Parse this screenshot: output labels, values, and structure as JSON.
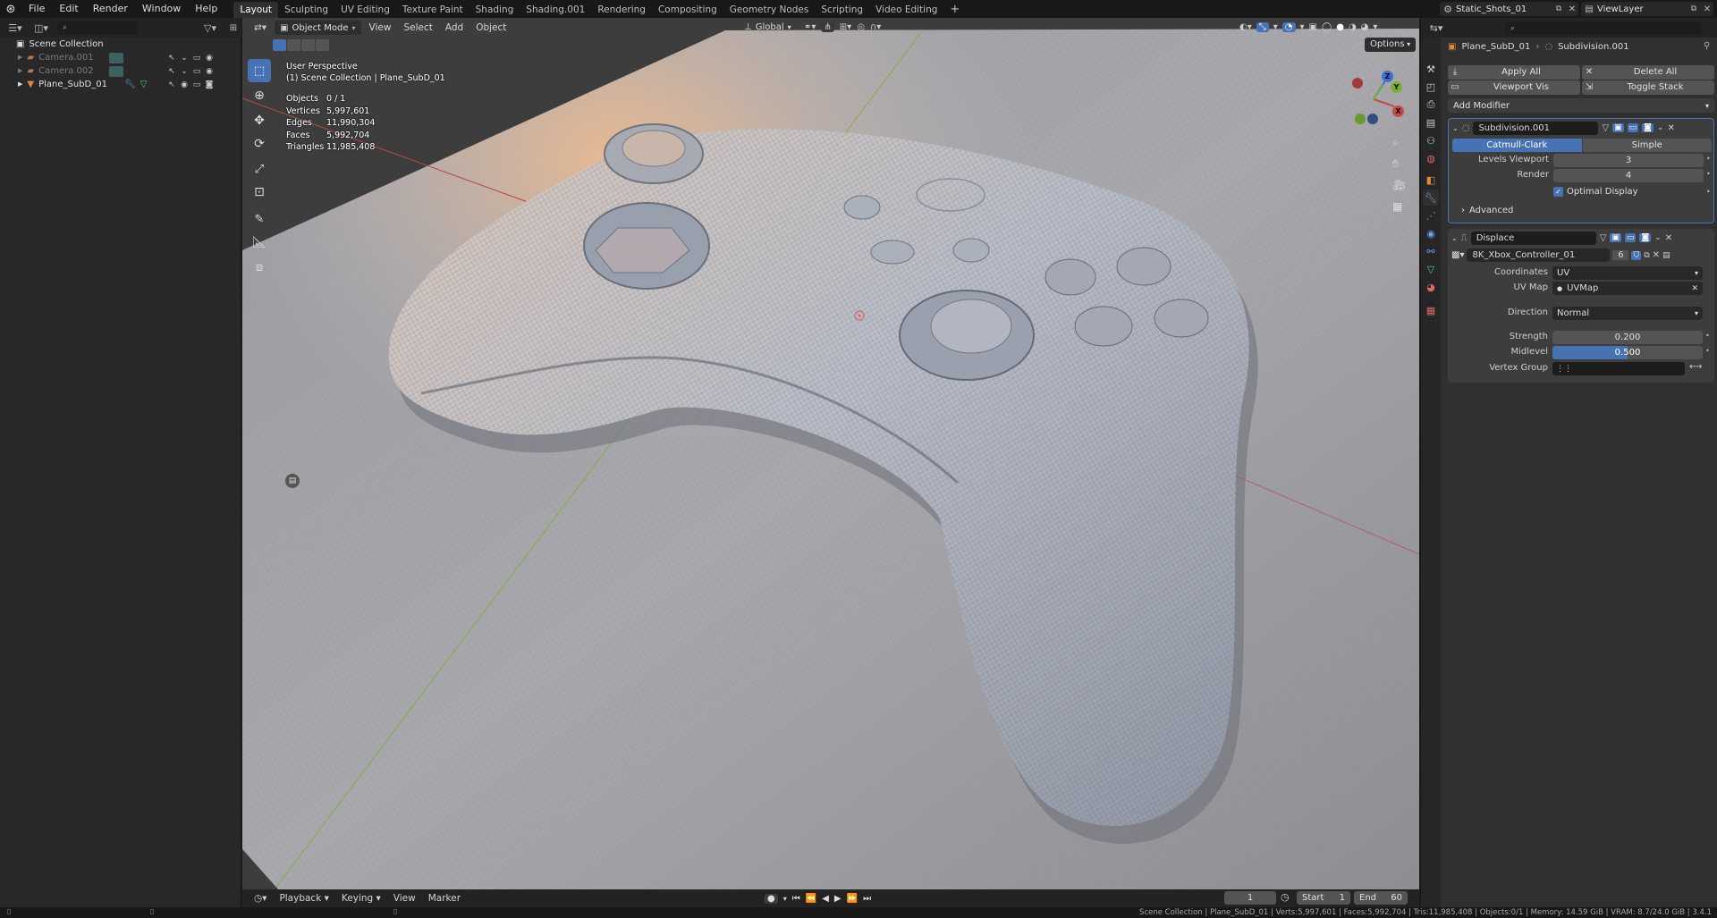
{
  "topbar": {
    "menus": [
      "File",
      "Edit",
      "Render",
      "Window",
      "Help"
    ],
    "workspaces": [
      "Layout",
      "Sculpting",
      "UV Editing",
      "Texture Paint",
      "Shading",
      "Shading.001",
      "Rendering",
      "Compositing",
      "Geometry Nodes",
      "Scripting",
      "Video Editing"
    ],
    "active_workspace": "Layout",
    "add_tab": "+",
    "scene_name": "Static_Shots_01",
    "view_layer": "ViewLayer"
  },
  "outliner": {
    "root": "Scene Collection",
    "items": [
      {
        "name": "Camera.001",
        "enabled": false
      },
      {
        "name": "Camera.002",
        "enabled": false
      },
      {
        "name": "Plane_SubD_01",
        "enabled": true
      }
    ]
  },
  "viewport": {
    "mode": "Object Mode",
    "menus": [
      "View",
      "Select",
      "Add",
      "Object"
    ],
    "orientation": "Global",
    "options": "Options",
    "title": "User Perspective",
    "context": "(1) Scene Collection | Plane_SubD_01",
    "stats": [
      {
        "label": "Objects",
        "value": "0 / 1"
      },
      {
        "label": "Vertices",
        "value": "5,997,601"
      },
      {
        "label": "Edges",
        "value": "11,990,304"
      },
      {
        "label": "Faces",
        "value": "5,992,704"
      },
      {
        "label": "Triangles",
        "value": "11,985,408"
      }
    ],
    "gizmo": {
      "x": "X",
      "y": "Y",
      "z": "Z"
    }
  },
  "properties": {
    "breadcrumb_object": "Plane_SubD_01",
    "breadcrumb_modifier": "Subdivision.001",
    "apply_all": "Apply All",
    "delete_all": "Delete All",
    "viewport_vis": "Viewport Vis",
    "toggle_stack": "Toggle Stack",
    "add_modifier": "Add Modifier",
    "subdiv": {
      "name": "Subdivision.001",
      "type_a": "Catmull-Clark",
      "type_b": "Simple",
      "levels_label": "Levels Viewport",
      "levels_value": "3",
      "render_label": "Render",
      "render_value": "4",
      "optimal_display": "Optimal Display",
      "advanced": "Advanced"
    },
    "displace": {
      "name": "Displace",
      "texture": "8K_Xbox_Controller_01",
      "texture_users": "6",
      "coordinates_label": "Coordinates",
      "coordinates_value": "UV",
      "uvmap_label": "UV Map",
      "uvmap_value": "UVMap",
      "direction_label": "Direction",
      "direction_value": "Normal",
      "strength_label": "Strength",
      "strength_value": "0.200",
      "midlevel_label": "Midlevel",
      "midlevel_value": "0.500",
      "midlevel_fraction": 0.5,
      "vertex_group_label": "Vertex Group"
    }
  },
  "timeline": {
    "menus": [
      "Playback",
      "Keying",
      "View",
      "Marker"
    ],
    "current_frame": "1",
    "start_label": "Start",
    "start_value": "1",
    "end_label": "End",
    "end_value": "60"
  },
  "statusbar": {
    "text": "Scene Collection | Plane_SubD_01 | Verts:5,997,601 | Faces:5,992,704 | Tris:11,985,408 | Objects:0/1 | Memory: 14.59 GiB | VRAM: 8.7/24.0 GiB | 3.4.1"
  },
  "colors": {
    "accent": "#4772b3",
    "panel": "#303030",
    "header": "#232323",
    "x_axis": "#c84848",
    "y_axis": "#7ab02e",
    "z_axis": "#3f6fd6"
  }
}
